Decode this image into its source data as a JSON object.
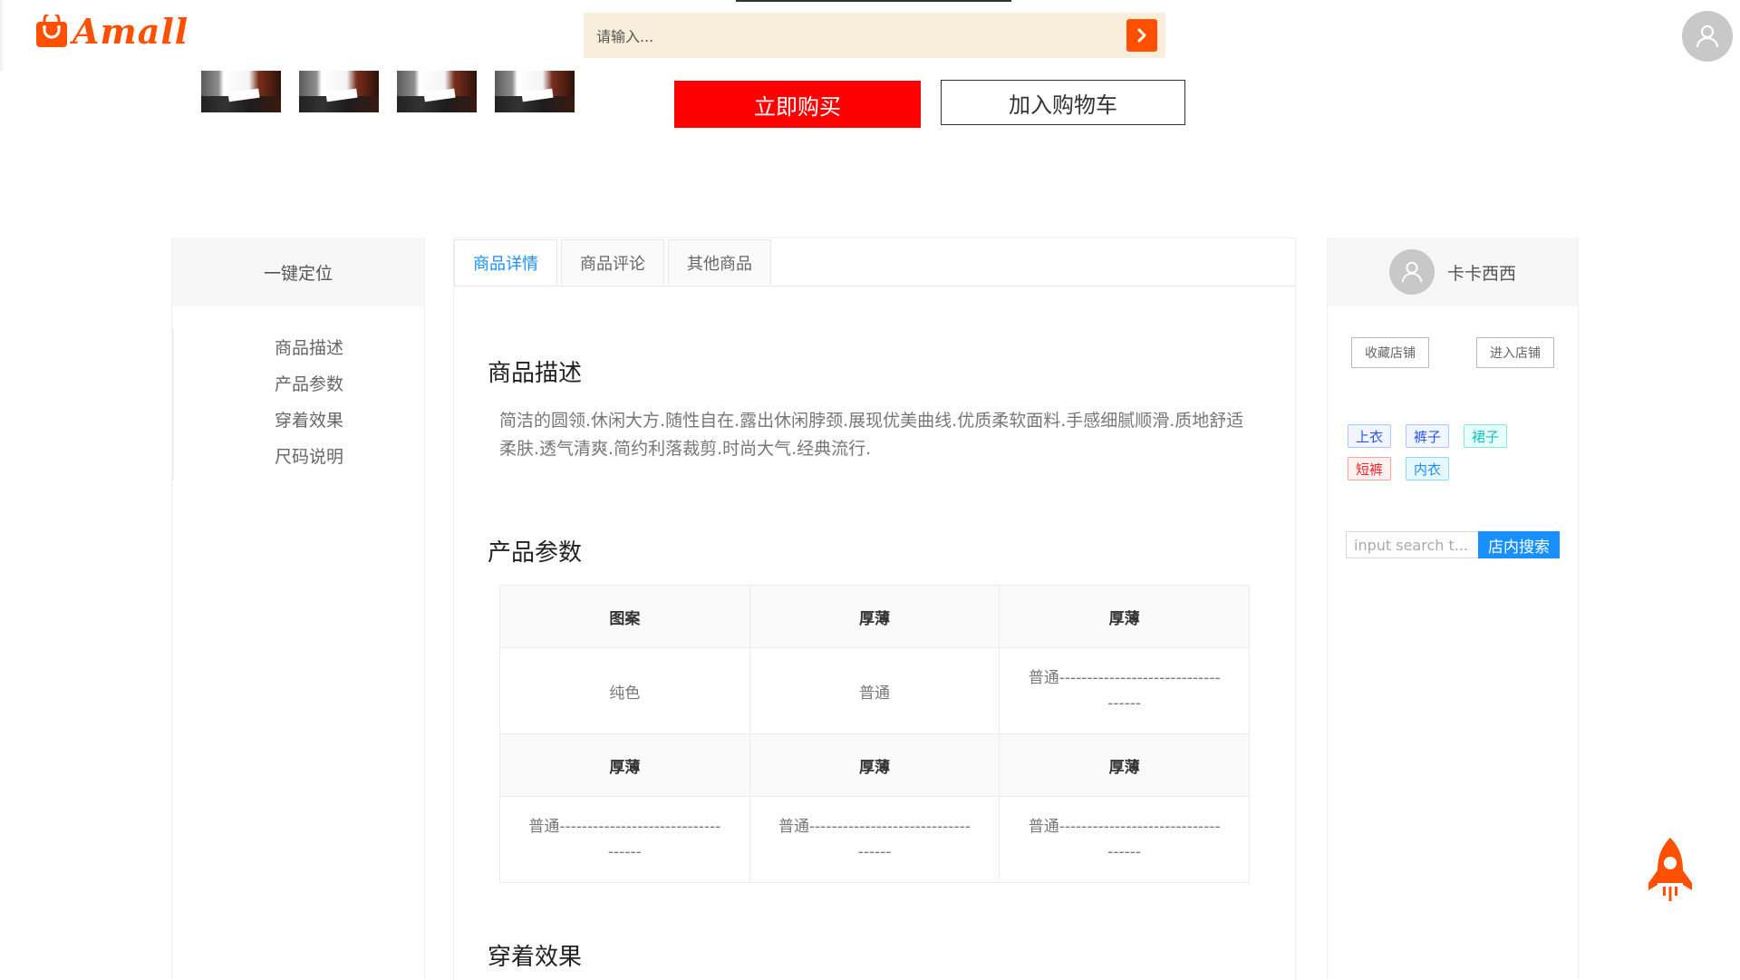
{
  "header": {
    "logo_text": "Amall",
    "search_placeholder": "请输入..."
  },
  "product": {
    "thumbnail_count": 4,
    "buy_now_label": "立即购买",
    "add_to_cart_label": "加入购物车"
  },
  "left_nav": {
    "title": "一键定位",
    "items": [
      {
        "label": "商品描述"
      },
      {
        "label": "产品参数"
      },
      {
        "label": "穿着效果"
      },
      {
        "label": "尺码说明"
      }
    ]
  },
  "main": {
    "tabs": [
      {
        "label": "商品详情",
        "active": true
      },
      {
        "label": "商品评论",
        "active": false
      },
      {
        "label": "其他商品",
        "active": false
      }
    ],
    "description_title": "商品描述",
    "description_text": "简洁的圆领.休闲大方.随性自在.露出休闲脖颈.展现优美曲线.优质柔软面料.手感细腻顺滑.质地舒适柔肤.透气清爽.简约利落裁剪.时尚大气.经典流行.",
    "params_title": "产品参数",
    "params_table": {
      "rows": [
        {
          "type": "header",
          "cells": [
            "图案",
            "厚薄",
            "厚薄"
          ]
        },
        {
          "type": "data",
          "cells": [
            "纯色",
            "普通",
            "普通-----------------------------------"
          ]
        },
        {
          "type": "header",
          "cells": [
            "厚薄",
            "厚薄",
            "厚薄"
          ]
        },
        {
          "type": "data",
          "cells": [
            "普通-----------------------------------",
            "普通-----------------------------------",
            "普通-----------------------------------"
          ]
        }
      ]
    },
    "wearing_title": "穿着效果"
  },
  "shop": {
    "name": "卡卡西西",
    "favorite_label": "收藏店铺",
    "enter_label": "进入店铺",
    "tags": [
      {
        "label": "上衣",
        "color": "#2f54eb",
        "bg": "#f0f5ff",
        "border": "#adc6ff"
      },
      {
        "label": "裤子",
        "color": "#2f54eb",
        "bg": "#f0f5ff",
        "border": "#adc6ff"
      },
      {
        "label": "裙子",
        "color": "#13c2c2",
        "bg": "#e6fffb",
        "border": "#87e8de"
      },
      {
        "label": "短裤",
        "color": "#f5222d",
        "bg": "#fff1f0",
        "border": "#ffa39e"
      },
      {
        "label": "内衣",
        "color": "#1890ff",
        "bg": "#e6f7ff",
        "border": "#91d5ff"
      }
    ],
    "search_placeholder": "input search t...",
    "search_button_label": "店内搜索"
  },
  "colors": {
    "brand": "#ff5000",
    "buy_button": "#ff0000",
    "accent_blue": "#1890ff",
    "search_bg": "#f8eedb"
  }
}
